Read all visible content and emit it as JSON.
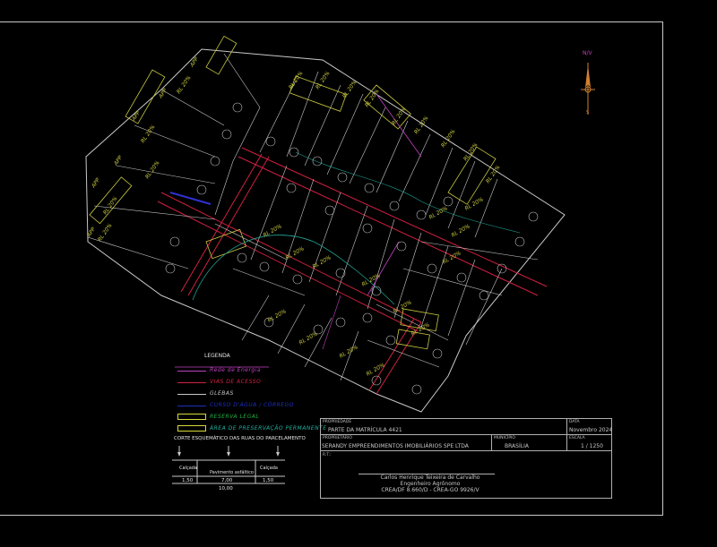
{
  "north_label": "N/V",
  "legend": {
    "title": "LEGENDA",
    "items": [
      {
        "label": "Rede de Energia",
        "color": "#c040c0",
        "kind": "line"
      },
      {
        "label": "VIAS DE ACESSO",
        "color": "#d02040",
        "kind": "line"
      },
      {
        "label": "GLEBAS",
        "color": "#c8c8c8",
        "kind": "line"
      },
      {
        "label": "CURSO D'ÁGUA / CÓRREGO",
        "color": "#2030c0",
        "kind": "line"
      },
      {
        "label": "RESERVA LEGAL",
        "color": "#20b040",
        "kind": "box"
      },
      {
        "label": "ÁREA DE PRESERVAÇÃO PERMANENTE",
        "color": "#20b0a0",
        "kind": "box"
      }
    ]
  },
  "section": {
    "title": "CORTE ESQUEMÁTICO DAS RUAS DO PARCELAMENTO",
    "left_label": "Calçada",
    "center_label": "Pavimento asfáltico",
    "right_label": "Calçada",
    "left_value": "1,50",
    "center_value": "7,00",
    "right_value": "1,50",
    "total_value": "10,00"
  },
  "title_block": {
    "property_label": "PROPRIEDADE",
    "property_value": "PARTE DA MATRÍCULA 4421",
    "owner_label": "PROPRIETÁRIO",
    "owner_value": "SERANDY EMPREENDIMENTOS IMOBILIÁRIOS SPE LTDA",
    "city_label": "MUNICÍPIO",
    "city_value": "BRASÍLIA",
    "date_label": "DATA",
    "date_value": "Novembro 2024",
    "scale_label": "ESCALA",
    "scale_value": "1 / 1250",
    "rt_label": "R.T.:",
    "engineer_name": "Carlos Henrique Teixeira de Carvalho",
    "engineer_title": "Engenheiro Agrônomo",
    "engineer_reg": "CREA/DF 8.660/D - CREA-GO 9926/V"
  },
  "map": {
    "lot_label": "RL 20%",
    "app_label": "APP"
  }
}
